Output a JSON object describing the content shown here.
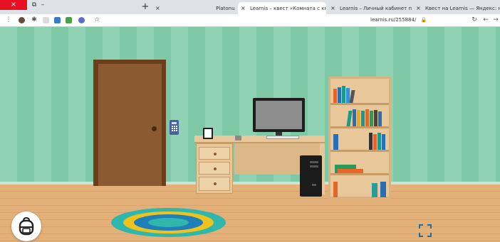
{
  "browser": {
    "tabs": [
      {
        "label": "Platonus",
        "active": false
      },
      {
        "label": "Learnis – квест «Комната с книг…",
        "active": true
      },
      {
        "label": "Learnis – Личный кабинет пол…",
        "active": false
      },
      {
        "label": "Квест на Learnis — Яндекс: нас…",
        "active": false
      }
    ],
    "new_tab": "+",
    "tab_close": "×",
    "window_close": "×",
    "url": "learnis.ru/255884/",
    "bookmark_star": "☆"
  },
  "game": {
    "inventory_icon": "backpack-icon",
    "fullscreen_icon": "expand-icon"
  },
  "colors": {
    "wall": "#8fd3b4",
    "floor": "#e3b07a",
    "door": "#8b5a30",
    "rug_outer": "#2fb7ad",
    "rug_yellow": "#f0c21e",
    "rug_blue": "#1f7fb9"
  }
}
